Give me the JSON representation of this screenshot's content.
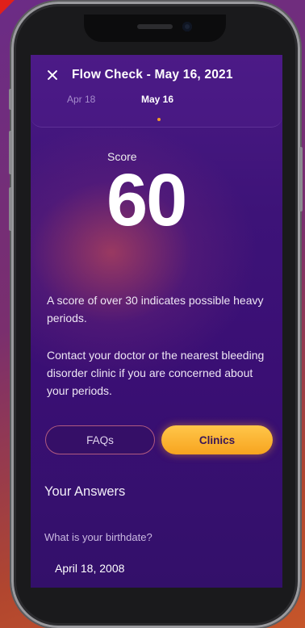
{
  "header": {
    "title": "Flow Check - May 16, 2021",
    "dates": [
      {
        "label": "Apr 18",
        "active": false
      },
      {
        "label": "May 16",
        "active": true
      }
    ]
  },
  "score": {
    "label": "Score",
    "value": "60"
  },
  "info": {
    "paragraph1": "A score of over 30 indicates possible heavy periods.",
    "paragraph2": "Contact your doctor or the nearest bleeding disorder clinic if you are concerned about your periods."
  },
  "buttons": {
    "faqs": "FAQs",
    "clinics": "Clinics"
  },
  "answers": {
    "heading": "Your Answers",
    "items": [
      {
        "question": "What is your birthdate?",
        "answer": "April 18, 2008"
      }
    ]
  },
  "colors": {
    "accent": "#f7a41f",
    "background": "#3d1378",
    "page_indicator": "#f29a2a"
  }
}
